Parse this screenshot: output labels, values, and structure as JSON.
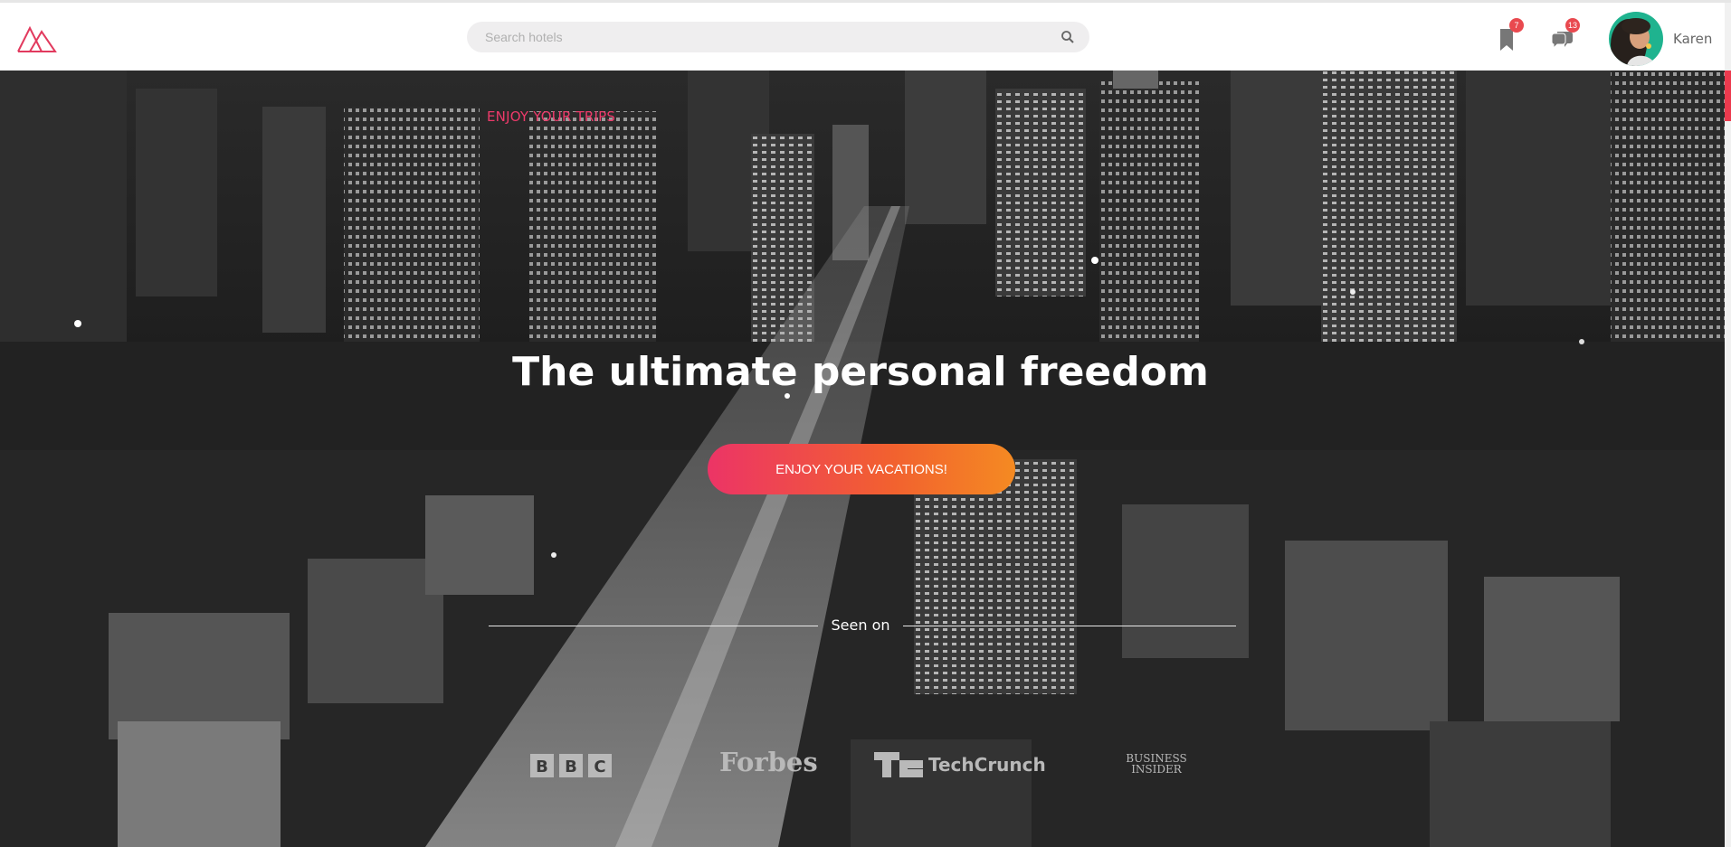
{
  "header": {
    "search": {
      "placeholder": "Search hotels"
    },
    "bookmarks": {
      "badge": "7"
    },
    "messages": {
      "badge": "13"
    },
    "user": {
      "name": "Karen"
    }
  },
  "hero": {
    "eyebrow": "ENJOY YOUR TRIPS",
    "title": "The ultimate personal freedom",
    "cta_label": "ENJOY YOUR VACATIONS!",
    "seen_on_label": "Seen on",
    "press_logos": [
      "BBC",
      "Forbes",
      "TechCrunch",
      "BUSINESS INSIDER"
    ]
  },
  "colors": {
    "accent": "#ec3a6a",
    "cta_gradient_start": "#ec3466",
    "cta_gradient_end": "#f48a22",
    "badge": "#e9494f"
  },
  "icons": [
    "logo-icon",
    "search-icon",
    "bookmark-icon",
    "chat-icon"
  ]
}
